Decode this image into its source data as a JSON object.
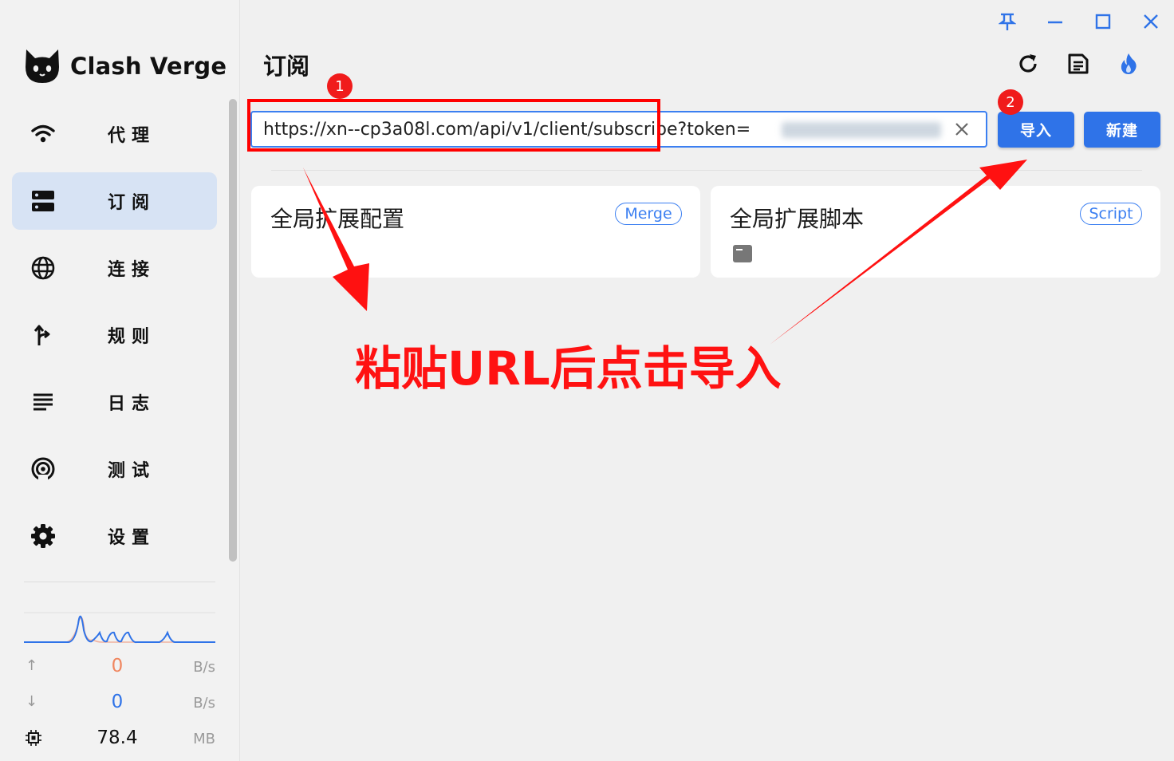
{
  "app": {
    "name": "Clash Verge"
  },
  "window_controls": [
    {
      "icon": "pin-icon"
    },
    {
      "icon": "minimize-icon"
    },
    {
      "icon": "maximize-icon"
    },
    {
      "icon": "close-icon"
    }
  ],
  "nav": [
    {
      "label": "代理",
      "icon": "wifi-icon",
      "active": false
    },
    {
      "label": "订阅",
      "icon": "dns-icon",
      "active": true
    },
    {
      "label": "连接",
      "icon": "globe-icon",
      "active": false
    },
    {
      "label": "规则",
      "icon": "fork-icon",
      "active": false
    },
    {
      "label": "日志",
      "icon": "list-icon",
      "active": false
    },
    {
      "label": "测试",
      "icon": "radar-icon",
      "active": false
    },
    {
      "label": "设置",
      "icon": "gear-icon",
      "active": false
    }
  ],
  "stats": {
    "upload": {
      "value": "0",
      "unit": "B/s"
    },
    "download": {
      "value": "0",
      "unit": "B/s"
    },
    "memory": {
      "value": "78.4",
      "unit": "MB"
    }
  },
  "page": {
    "title": "订阅",
    "actions": [
      {
        "icon": "refresh-icon"
      },
      {
        "icon": "document-icon"
      },
      {
        "icon": "fire-icon"
      }
    ]
  },
  "import_bar": {
    "url": "https://xn--cp3a08l.com/api/v1/client/subscribe?token=",
    "import_label": "导入",
    "new_label": "新建"
  },
  "cards": [
    {
      "title": "全局扩展配置",
      "tag": "Merge"
    },
    {
      "title": "全局扩展脚本",
      "tag": "Script"
    }
  ],
  "annotation": {
    "badge1": "1",
    "badge2": "2",
    "callout": "粘贴URL后点击导入"
  },
  "colors": {
    "accent": "#2f73e8",
    "active_nav": "#d7e3f4",
    "annotation_red": "#ff1212"
  }
}
